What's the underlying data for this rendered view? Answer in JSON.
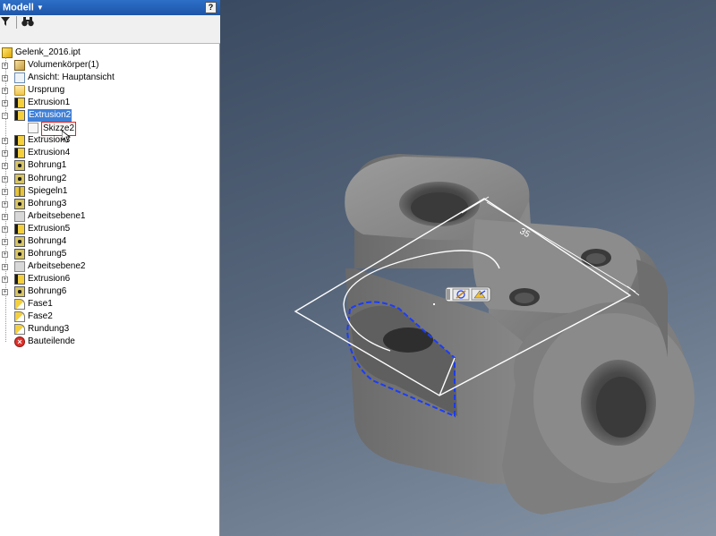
{
  "panel": {
    "title": "Modell",
    "help_label": "?"
  },
  "tree": {
    "root": "Gelenk_2016.ipt",
    "items": [
      {
        "label": "Volumenkörper(1)",
        "icon": "solid-body-icon"
      },
      {
        "label": "Ansicht: Hauptansicht",
        "icon": "view-icon"
      },
      {
        "label": "Ursprung",
        "icon": "folder-icon"
      },
      {
        "label": "Extrusion1",
        "icon": "extrusion-icon"
      },
      {
        "label": "Extrusion2",
        "icon": "extrusion-icon"
      },
      {
        "label": "Skizze2",
        "icon": "sketch-icon"
      },
      {
        "label": "Extrusion3",
        "icon": "extrusion-icon"
      },
      {
        "label": "Extrusion4",
        "icon": "extrusion-icon"
      },
      {
        "label": "Bohrung1",
        "icon": "hole-icon"
      },
      {
        "label": "Bohrung2",
        "icon": "hole-icon"
      },
      {
        "label": "Spiegeln1",
        "icon": "mirror-icon"
      },
      {
        "label": "Bohrung3",
        "icon": "hole-icon"
      },
      {
        "label": "Arbeitsebene1",
        "icon": "work-plane-icon"
      },
      {
        "label": "Extrusion5",
        "icon": "extrusion-icon"
      },
      {
        "label": "Bohrung4",
        "icon": "hole-icon"
      },
      {
        "label": "Bohrung5",
        "icon": "hole-icon"
      },
      {
        "label": "Arbeitsebene2",
        "icon": "work-plane-icon"
      },
      {
        "label": "Extrusion6",
        "icon": "extrusion-icon"
      },
      {
        "label": "Bohrung6",
        "icon": "hole-icon"
      },
      {
        "label": "Fase1",
        "icon": "chamfer-icon"
      },
      {
        "label": "Fase2",
        "icon": "chamfer-icon"
      },
      {
        "label": "Rundung3",
        "icon": "fillet-icon"
      },
      {
        "label": "Bauteilende",
        "icon": "end-of-part-icon"
      }
    ]
  },
  "viewport": {
    "dimension_label": "35",
    "sketch_color": "#ffffff",
    "highlight_color": "#1a3cff"
  }
}
